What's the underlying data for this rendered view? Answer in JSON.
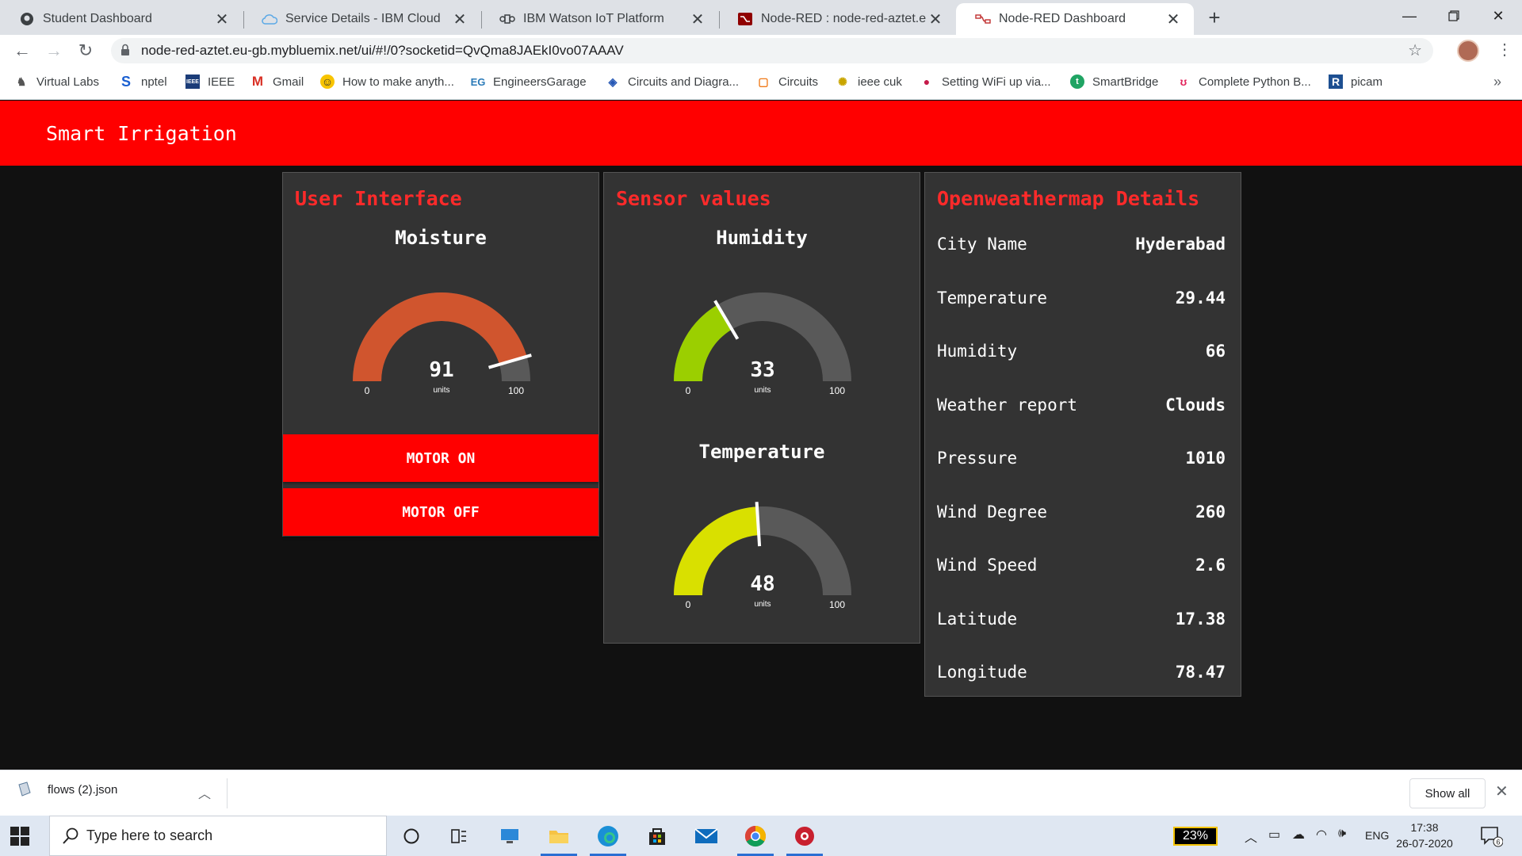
{
  "browser": {
    "tabs": [
      {
        "title": "Student Dashboard",
        "icon": "github-icon"
      },
      {
        "title": "Service Details - IBM Cloud",
        "icon": "cloud-icon"
      },
      {
        "title": "IBM Watson IoT Platform",
        "icon": "iot-icon"
      },
      {
        "title": "Node-RED : node-red-aztet.eu-gb",
        "icon": "node-red-icon"
      },
      {
        "title": "Node-RED Dashboard",
        "icon": "node-red-flow-icon",
        "active": true
      }
    ],
    "url": "node-red-aztet.eu-gb.mybluemix.net/ui/#!/0?socketid=QvQma8JAEkI0vo07AAAV",
    "bookmarks": [
      {
        "label": "Virtual Labs",
        "icon": "virtual-labs-icon"
      },
      {
        "label": "nptel",
        "icon": "s-icon"
      },
      {
        "label": "IEEE",
        "icon": "ieee-icon"
      },
      {
        "label": "Gmail",
        "icon": "gmail-icon"
      },
      {
        "label": "How to make anyth...",
        "icon": "instructables-icon"
      },
      {
        "label": "EngineersGarage",
        "icon": "eg-icon"
      },
      {
        "label": "Circuits and Diagra...",
        "icon": "diamond-icon"
      },
      {
        "label": "Circuits",
        "icon": "circuits-icon"
      },
      {
        "label": "ieee cuk",
        "icon": "ieee-cuk-icon"
      },
      {
        "label": "Setting WiFi up via...",
        "icon": "raspberry-icon"
      },
      {
        "label": "SmartBridge",
        "icon": "smartbridge-icon"
      },
      {
        "label": "Complete Python B...",
        "icon": "udemy-icon"
      },
      {
        "label": "picam",
        "icon": "r-icon"
      }
    ]
  },
  "dashboard": {
    "title": "Smart Irrigation",
    "accent": "#ff0000",
    "ui_card": {
      "title": "User Interface",
      "gauge": {
        "label": "Moisture",
        "value": 91,
        "units": "units",
        "min": 0,
        "max": 100,
        "color": "#d0552e"
      },
      "buttons": {
        "on": "MOTOR ON",
        "off": "MOTOR OFF"
      }
    },
    "sensor_card": {
      "title": "Sensor values",
      "humidity": {
        "label": "Humidity",
        "value": 33,
        "units": "units",
        "min": 0,
        "max": 100,
        "color": "#9bcf00"
      },
      "temperature": {
        "label": "Temperature",
        "value": 48,
        "units": "units",
        "min": 0,
        "max": 100,
        "color": "#d9e000"
      }
    },
    "weather_card": {
      "title": "Openweathermap Details",
      "rows": [
        {
          "label": "City Name",
          "value": "Hyderabad"
        },
        {
          "label": "Temperature",
          "value": "29.44"
        },
        {
          "label": "Humidity",
          "value": "66"
        },
        {
          "label": "Weather report",
          "value": "Clouds"
        },
        {
          "label": "Pressure",
          "value": "1010"
        },
        {
          "label": "Wind Degree",
          "value": "260"
        },
        {
          "label": "Wind Speed",
          "value": "2.6"
        },
        {
          "label": "Latitude",
          "value": "17.38"
        },
        {
          "label": "Longitude",
          "value": "78.47"
        }
      ]
    }
  },
  "downloads": {
    "file": "flows (2).json",
    "show_all": "Show all"
  },
  "taskbar": {
    "search_placeholder": "Type here to search",
    "battery": "23%",
    "language": "ENG",
    "time": "17:38",
    "date": "26-07-2020",
    "notifications": "6"
  }
}
